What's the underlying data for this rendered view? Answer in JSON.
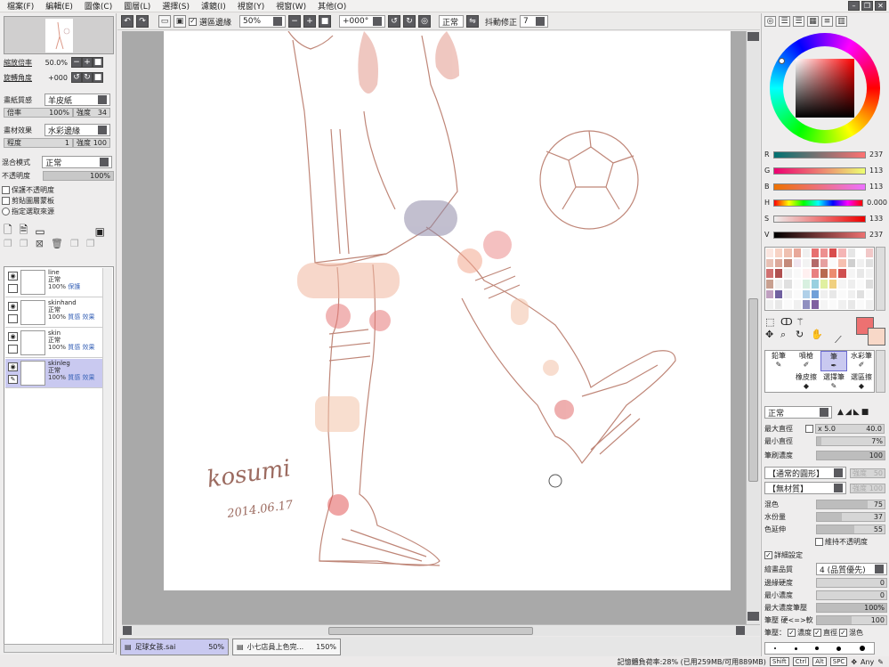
{
  "menu": [
    "檔案(F)",
    "編輯(E)",
    "圖像(C)",
    "圖層(L)",
    "選擇(S)",
    "濾鏡(I)",
    "視窗(Y)",
    "視窗(W)",
    "其他(O)"
  ],
  "toolbar": {
    "sel_edge_label": "選區邊緣",
    "zoom": "50%",
    "angle": "+000°",
    "mode": "正常",
    "stabilizer_label": "抖動修正",
    "stabilizer_value": "7"
  },
  "navigator": {
    "zoom_label": "縮放倍率",
    "zoom_value": "50.0%",
    "rotate_label": "旋轉角度",
    "rotate_value": "+000"
  },
  "paper": {
    "texture_label": "畫紙質感",
    "texture_value": "羊皮紙",
    "ratio_label": "倍率",
    "ratio_value": "100%",
    "strength_label": "強度",
    "strength_value": "34",
    "effect_label": "畫材效果",
    "effect_value": "水彩邊緣",
    "degree_label": "程度",
    "degree_value": "1",
    "effect_strength_label": "強度",
    "effect_strength_value": "100"
  },
  "blend": {
    "mode_label": "混合模式",
    "mode_value": "正常",
    "opacity_label": "不透明度",
    "opacity_value": "100%",
    "opt1": "保護不透明度",
    "opt2": "剪貼圖層蒙板",
    "opt3": "指定選取來源"
  },
  "layers": [
    {
      "name": "line",
      "mode": "正常",
      "opacity": "100%",
      "tag": "保護"
    },
    {
      "name": "skinhand",
      "mode": "正常",
      "opacity": "100%",
      "tag": "質感 效果"
    },
    {
      "name": "skin",
      "mode": "正常",
      "opacity": "100%",
      "tag": "質感 效果"
    },
    {
      "name": "skinleg",
      "mode": "正常",
      "opacity": "100%",
      "tag": "質感 效果"
    }
  ],
  "signature": {
    "name": "kosumi",
    "date": "2014.06.17"
  },
  "tabs": [
    {
      "name": "足球女孩.sai",
      "zoom": "50%"
    },
    {
      "name": "小七店員上色完...",
      "zoom": "150%"
    }
  ],
  "status": {
    "memory": "記憶體負荷率:28% (已用259MB/可用889MB)",
    "keys": [
      "Shift",
      "Ctrl",
      "Alt",
      "SPC"
    ],
    "any": "Any"
  },
  "color": {
    "r_label": "R",
    "r": "237",
    "g_label": "G",
    "g": "113",
    "b_label": "B",
    "b": "113",
    "h_label": "H",
    "h": "0.000",
    "s_label": "S",
    "s": "133",
    "v_label": "V",
    "v": "237",
    "current": "#ed7171",
    "secondary": "#f8d8c8"
  },
  "tools": [
    "鉛筆",
    "噴槍",
    "筆",
    "水彩筆",
    "橡皮擦",
    "選擇筆",
    "選區擦"
  ],
  "brush": {
    "mode": "正常",
    "max_size_label": "最大直徑",
    "max_size_mult": "x 5.0",
    "max_size_value": "40.0",
    "min_size_label": "最小直徑",
    "min_size_value": "7%",
    "density_label": "筆刷濃度",
    "density_value": "100",
    "shape1": "【通常的圓形】",
    "shape1_strength": "強度",
    "shape1_value": "50",
    "shape2": "【無材質】",
    "shape2_strength": "強度",
    "shape2_value": "100",
    "blend_label": "混色",
    "blend_value": "75",
    "water_label": "水份量",
    "water_value": "37",
    "extend_label": "色延伸",
    "extend_value": "55",
    "keep_opacity": "維持不透明度",
    "detail_label": "詳細設定",
    "quality_label": "繪畫品質",
    "quality_value": "4 (品質優先)",
    "edge_label": "邊緣硬度",
    "edge_value": "0",
    "min_density_label": "最小濃度",
    "min_density_value": "0",
    "max_pressure_label": "最大濃度筆壓",
    "max_pressure_value": "100%",
    "hardness_label": "筆壓 硬<=>軟",
    "hardness_value": "100",
    "pressure_label": "筆壓：",
    "p1": "濃度",
    "p2": "直徑",
    "p3": "混色"
  }
}
